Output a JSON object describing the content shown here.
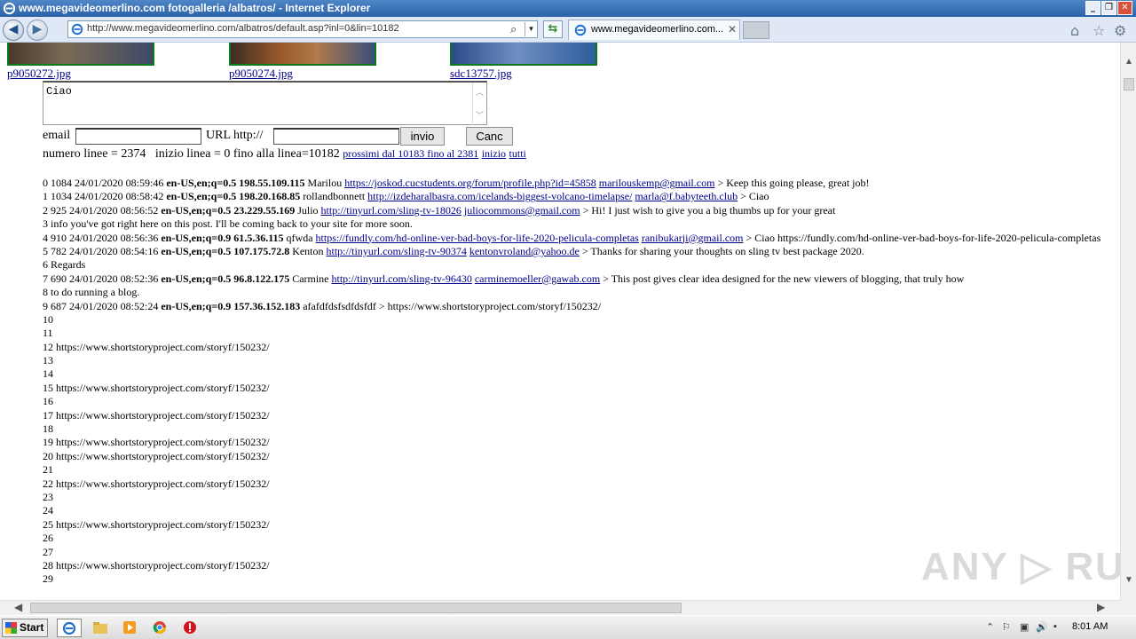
{
  "window": {
    "title": "www.megavideomerlino.com fotogalleria /albatros/ - Internet Explorer",
    "minimize": "_",
    "restore": "❐",
    "close": "✕"
  },
  "browser": {
    "back_glyph": "◀",
    "forward_glyph": "▶",
    "url": "http://www.megavideomerlino.com/albatros/default.asp?inl=0&lin=10182",
    "search_glyph": "⌕",
    "dropdown_glyph": "▼",
    "refresh_glyph": "⇆",
    "tab_title": "www.megavideomerlino.com...",
    "tab_close": "✕",
    "home_glyph": "⌂",
    "favorites_glyph": "☆",
    "tools_glyph": "⚙"
  },
  "gallery": {
    "thumbs": [
      {
        "label": "p9050272.jpg"
      },
      {
        "label": "p9050274.jpg"
      },
      {
        "label": "sdc13757.jpg"
      }
    ]
  },
  "form": {
    "comment_value": "Ciao",
    "email_label": "email",
    "url_label": "URL http://",
    "submit_label": "invio",
    "cancel_label": "Canc"
  },
  "stats": {
    "text": "numero linee = 2374   inizio linea = 0 fino alla linea=10182",
    "next_link": "prossimi dal 10183 fino al 2381",
    "start_link": "inizio",
    "all_link": "tutti"
  },
  "entries": {
    "e0": {
      "pre": "0 1084 24/01/2020 08:59:46 ",
      "bold": "en-US,en;q=0.5 198.55.109.115",
      "name": " Marilou ",
      "link": "https://joskod.cucstudents.org/forum/profile.php?id=45858",
      "email": "marilouskemp@gmail.com",
      "msg": " > Keep this going please, great job!"
    },
    "e1": {
      "pre": "1 1034 24/01/2020 08:58:42 ",
      "bold": "en-US,en;q=0.5 198.20.168.85",
      "name": " rollandbonnett ",
      "link": "http://izdeharalbasra.com/icelands-biggest-volcano-timelapse/",
      "email": "marla@f.babyteeth.club",
      "msg": " > Ciao"
    },
    "e2": {
      "pre": "2 925 24/01/2020 08:56:52 ",
      "bold": "en-US,en;q=0.5 23.229.55.169",
      "name": " Julio ",
      "link": "http://tinyurl.com/sling-tv-18026",
      "email": "juliocommons@gmail.com",
      "msg": " > Hi! I just wish to give you a big thumbs up for your great"
    },
    "l3": "3 info you've got right here on this post. I'll be coming back to your site for more soon.",
    "e4": {
      "pre": "4 910 24/01/2020 08:56:36 ",
      "bold": "en-US,en;q=0.9 61.5.36.115",
      "name": " qfwda ",
      "link": "https://fundly.com/hd-online-ver-bad-boys-for-life-2020-pelicula-completas",
      "email": "ranibukarji@gmail.com",
      "msg": " > Ciao https://fundly.com/hd-online-ver-bad-boys-for-life-2020-pelicula-completas"
    },
    "e5": {
      "pre": "5 782 24/01/2020 08:54:16 ",
      "bold": "en-US,en;q=0.5 107.175.72.8",
      "name": " Kenton ",
      "link": "http://tinyurl.com/sling-tv-90374",
      "email": "kentonvroland@yahoo.de",
      "msg": " > Thanks for sharing your thoughts on sling tv best package 2020."
    },
    "l6": "6 Regards",
    "e7": {
      "pre": "7 690 24/01/2020 08:52:36 ",
      "bold": "en-US,en;q=0.5 96.8.122.175",
      "name": " Carmine ",
      "link": "http://tinyurl.com/sling-tv-96430",
      "email": "carminemoeller@gawab.com",
      "msg": " > This post gives clear idea designed for the new viewers of blogging, that truly how"
    },
    "l8": "8 to do running a blog.",
    "e9": {
      "pre": "9 687 24/01/2020 08:52:24 ",
      "bold": "en-US,en;q=0.9 157.36.152.183",
      "name": " afafdfdsfsdfdsfdf > https://www.shortstoryproject.com/storyf/150232/"
    },
    "l10": "10",
    "l11": "11",
    "l12": "12 https://www.shortstoryproject.com/storyf/150232/",
    "l13": "13",
    "l14": "14",
    "l15": "15 https://www.shortstoryproject.com/storyf/150232/",
    "l16": "16",
    "l17": "17 https://www.shortstoryproject.com/storyf/150232/",
    "l18": "18",
    "l19": "19 https://www.shortstoryproject.com/storyf/150232/",
    "l20": "20 https://www.shortstoryproject.com/storyf/150232/",
    "l21": "21",
    "l22": "22 https://www.shortstoryproject.com/storyf/150232/",
    "l23": "23",
    "l24": "24",
    "l25": "25 https://www.shortstoryproject.com/storyf/150232/",
    "l26": "26",
    "l27": "27",
    "l28": "28 https://www.shortstoryproject.com/storyf/150232/",
    "l29": "29"
  },
  "watermark": "ANY ▷ RUN",
  "taskbar": {
    "start_label": "Start",
    "clock": "8:01 AM",
    "tray_up": "⌃",
    "tray_volume": "🔊"
  }
}
